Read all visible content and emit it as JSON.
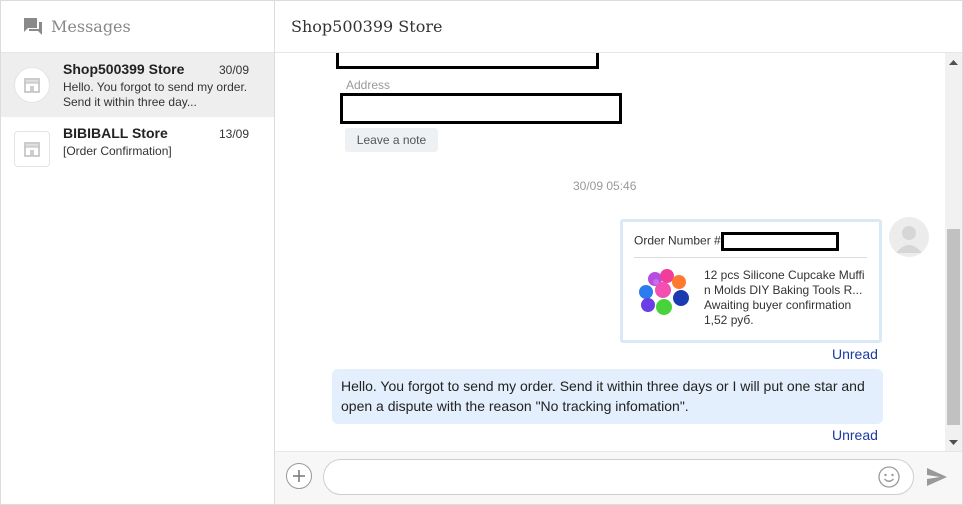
{
  "sidebar": {
    "title": "Messages",
    "conversations": [
      {
        "name": "Shop500399 Store",
        "date": "30/09",
        "preview": "Hello. You forgot to send my order. Send it within three day...",
        "active": true
      },
      {
        "name": "BIBIBALL Store",
        "date": "13/09",
        "preview": "[Order Confirmation]",
        "active": false
      }
    ]
  },
  "chat": {
    "title": "Shop500399 Store",
    "address_label": "Address",
    "leave_note": "Leave a note",
    "timestamp": "30/09 05:46",
    "order_card": {
      "order_number_label": "Order Number #",
      "product_title": "12 pcs Silicone Cupcake Muffin Molds DIY Baking Tools R...",
      "product_title_line1": "12 pcs Silicone Cupcake Muffi",
      "product_title_line2": "n Molds DIY Baking Tools R...",
      "status": "Awaiting buyer confirmation",
      "price": "1,52 руб."
    },
    "unread_1": "Unread",
    "message": "Hello. You forgot to send my order. Send it within three days or I will put one star and open a dispute with the reason \"No tracking infomation\".",
    "unread_2": "Unread"
  },
  "input": {
    "placeholder": ""
  },
  "icons": {
    "messages": "chat-bubbles-icon",
    "store": "store-icon",
    "plus": "plus-icon",
    "emoji": "smiley-icon",
    "send": "send-icon",
    "user_avatar": "user-avatar-icon"
  },
  "colors": {
    "active_conversation": "#eeeeee",
    "bubble": "#e3effc",
    "unread_link": "#1a3aa0",
    "card_border": "#dbe9f7"
  }
}
